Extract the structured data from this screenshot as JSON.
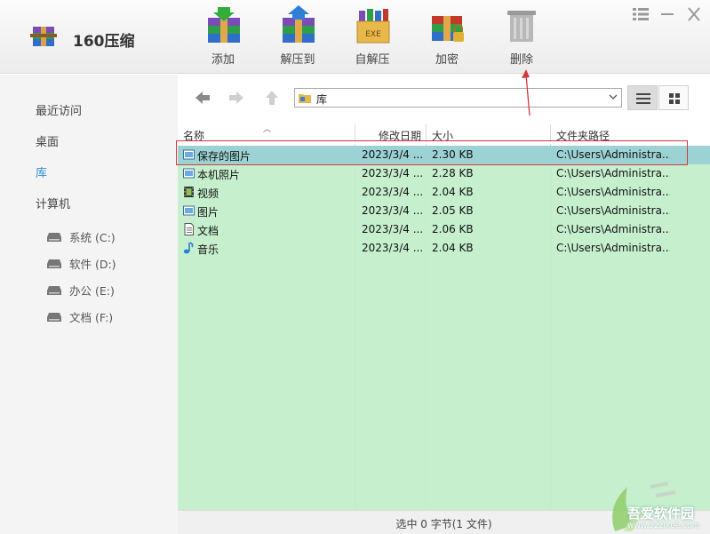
{
  "app": {
    "title": "160压缩"
  },
  "toolbar": [
    {
      "id": "add",
      "label": "添加"
    },
    {
      "id": "extract",
      "label": "解压到"
    },
    {
      "id": "sfx",
      "label": "自解压"
    },
    {
      "id": "encrypt",
      "label": "加密"
    },
    {
      "id": "delete",
      "label": "删除"
    }
  ],
  "sfx_badge": "EXE",
  "sidebar": {
    "items": [
      {
        "label": "最近访问",
        "active": false
      },
      {
        "label": "桌面",
        "active": false
      },
      {
        "label": "库",
        "active": true
      },
      {
        "label": "计算机",
        "active": false
      }
    ],
    "drives": [
      {
        "label": "系统 (C:)"
      },
      {
        "label": "软件 (D:)"
      },
      {
        "label": "办公 (E:)"
      },
      {
        "label": "文档 (F:)"
      }
    ]
  },
  "nav": {
    "path": "库"
  },
  "table": {
    "headers": [
      "名称",
      "修改日期",
      "大小",
      "文件夹路径"
    ],
    "rows": [
      {
        "name": "保存的图片",
        "date": "2023/3/4 ...",
        "size": "2.30 KB",
        "path": "C:\\Users\\Administra...",
        "icon": "picture-library-icon",
        "selected": true
      },
      {
        "name": "本机照片",
        "date": "2023/3/4 ...",
        "size": "2.28 KB",
        "path": "C:\\Users\\Administra...",
        "icon": "picture-library-icon",
        "selected": false
      },
      {
        "name": "视频",
        "date": "2023/3/4 ...",
        "size": "2.04 KB",
        "path": "C:\\Users\\Administra...",
        "icon": "video-library-icon",
        "selected": false
      },
      {
        "name": "图片",
        "date": "2023/3/4 ...",
        "size": "2.05 KB",
        "path": "C:\\Users\\Administra...",
        "icon": "picture-library-icon",
        "selected": false
      },
      {
        "name": "文档",
        "date": "2023/3/4 ...",
        "size": "2.06 KB",
        "path": "C:\\Users\\Administra...",
        "icon": "document-library-icon",
        "selected": false
      },
      {
        "name": "音乐",
        "date": "2023/3/4 ...",
        "size": "2.04 KB",
        "path": "C:\\Users\\Administra...",
        "icon": "music-library-icon",
        "selected": false
      }
    ]
  },
  "status": {
    "text": "选中 0 字节(1 文件)"
  },
  "watermark": {
    "text": "吾爱软件园",
    "url": "www.52zixue.com"
  },
  "colors": {
    "accent": "#2b8fd6",
    "content_bg": "#c6efce",
    "selected_row": "#9cd2d4",
    "annotation": "#d43a3a"
  }
}
